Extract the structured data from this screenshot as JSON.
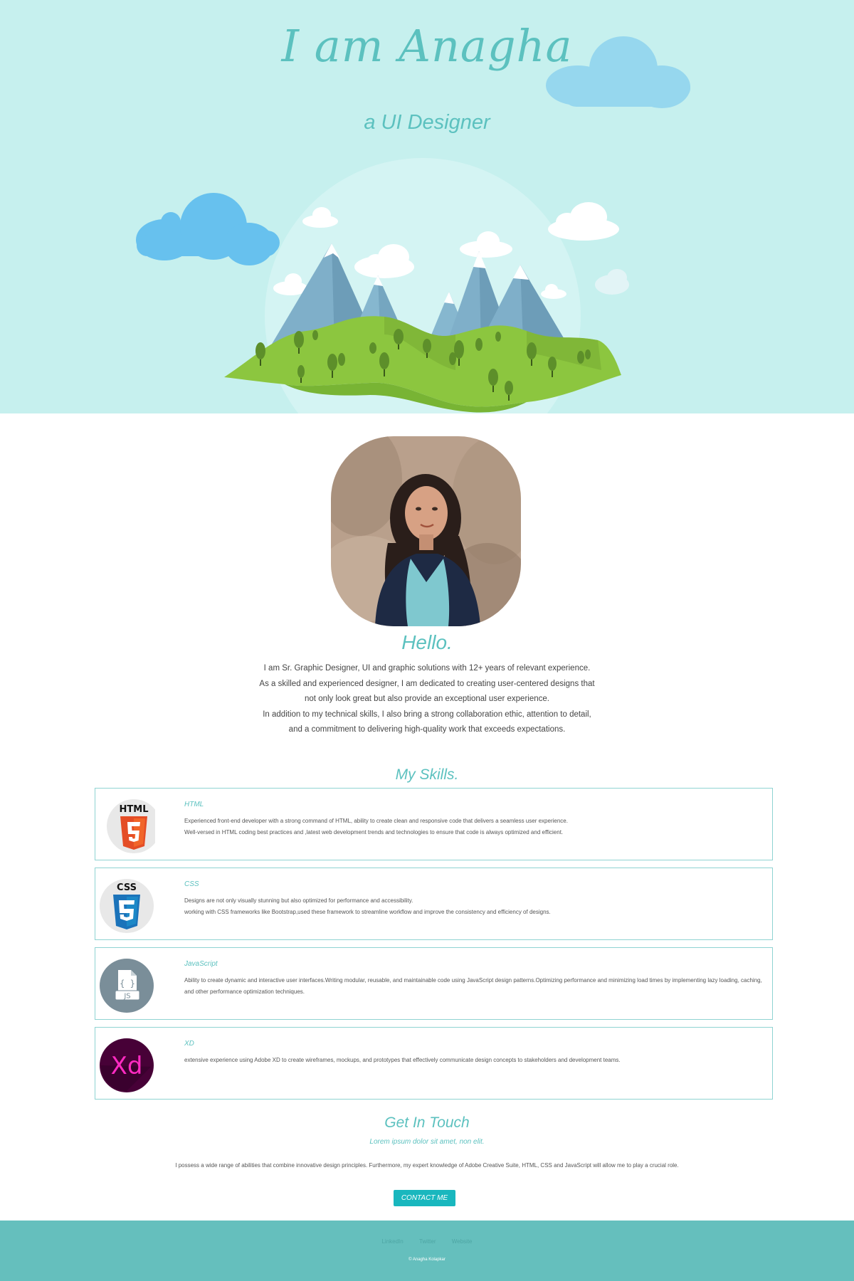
{
  "hero": {
    "title": "I am Anagha",
    "subtitle": "a UI Designer"
  },
  "about": {
    "heading": "Hello.",
    "bio_lines": [
      "I am Sr. Graphic Designer, UI and graphic solutions with 12+ years of relevant experience.",
      "As a skilled and experienced designer, I am dedicated to creating user-centered designs that",
      "not only look great but also provide an exceptional user experience.",
      "In addition to my technical skills, I also bring a strong collaboration ethic, attention to detail,",
      "and a commitment to delivering high-quality work that exceeds expectations."
    ]
  },
  "skills": {
    "heading": "My Skills.",
    "items": [
      {
        "name": "HTML",
        "icon": "html5-icon",
        "icon_label": "HTML",
        "lines": [
          "Experienced front-end developer with a strong command of HTML, ability to create clean and responsive code that delivers a seamless user experience.",
          "Well-versed in HTML coding best practices and ,latest web development trends and technologies to ensure that code is always optimized and efficient."
        ]
      },
      {
        "name": "CSS",
        "icon": "css3-icon",
        "icon_label": "CSS",
        "lines": [
          "Designs are not only visually stunning but also optimized for performance and accessibility.",
          "working with CSS frameworks like Bootstrap,used these framework to streamline workflow and improve the consistency and efficiency of designs."
        ]
      },
      {
        "name": "JavaScript",
        "icon": "javascript-file-icon",
        "icon_label": "JS",
        "lines": [
          "Ability to create dynamic and interactive user interfaces.Writing modular, reusable, and maintainable code using JavaScript design patterns.Optimizing performance and minimizing load times by implementing lazy loading, caching, and other performance optimization techniques."
        ]
      },
      {
        "name": "XD",
        "icon": "adobe-xd-icon",
        "icon_label": "Xd",
        "lines": [
          "extensive experience using Adobe XD to create wireframes, mockups, and prototypes that effectively communicate design concepts to stakeholders and development teams."
        ]
      }
    ]
  },
  "contact": {
    "heading": "Get In Touch",
    "subheading": "Lorem ipsum dolor sit amet, non elit.",
    "text": "I possess a wide range of abilities that combine innovative design principles. Furthermore, my expert knowledge of Adobe Creative Suite, HTML, CSS and JavaScript will allow me to play a crucial role.",
    "button_label": "CONTACT ME"
  },
  "footer": {
    "links": [
      "LinkedIn",
      "Twitter",
      "Website"
    ],
    "copyright": "© Anagha Kolapkar"
  },
  "colors": {
    "accent": "#5cc1bf",
    "hero_bg": "#c6f0ee",
    "footer_bg": "#65bfbd",
    "button_bg": "#19b7be",
    "card_border": "#8fd3d2"
  }
}
